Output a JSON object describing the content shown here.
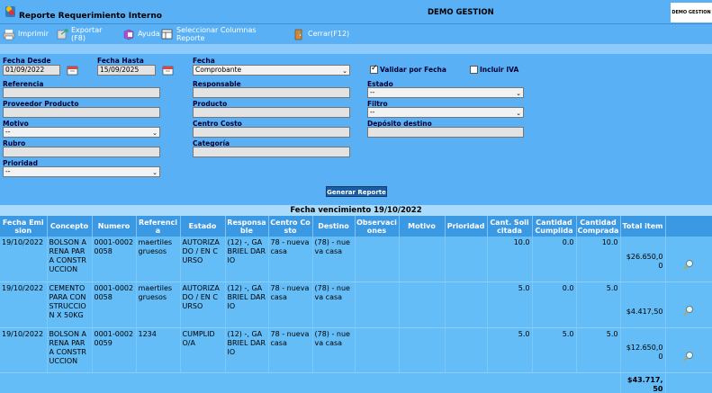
{
  "app": {
    "title": "Reporte Requerimiento Interno",
    "company": "DEMO GESTION",
    "logo_text": "DEMO GESTION"
  },
  "toolbar": {
    "print": "Imprimir",
    "export_l1": "Exportar",
    "export_l2": "(F8)",
    "help": "Ayuda",
    "columns_l1": "Seleccionar Columnas",
    "columns_l2": "Reporte",
    "close": "Cerrar(F12)"
  },
  "filters": {
    "fecha_desde_label": "Fecha Desde",
    "fecha_desde": "01/09/2022",
    "fecha_hasta_label": "Fecha Hasta",
    "fecha_hasta": "15/09/2025",
    "fecha_label": "Fecha",
    "fecha_select": "Comprobante",
    "validar_label": "Validar por Fecha",
    "validar_checked": true,
    "iva_label": "Incluir IVA",
    "iva_checked": false,
    "referencia_label": "Referencia",
    "responsable_label": "Responsable",
    "estado_label": "Estado",
    "estado_select": "--",
    "proveedor_label": "Proveedor Producto",
    "producto_label": "Producto",
    "filtro_label": "Filtro",
    "filtro_select": "--",
    "motivo_label": "Motivo",
    "motivo_select": "--",
    "centro_label": "Centro Costo",
    "deposito_label": "Depósito destino",
    "rubro_label": "Rubro",
    "categoria_label": "Categoría",
    "prioridad_label": "Prioridad",
    "prioridad_select": "--",
    "generate_button": "Generar Reporte"
  },
  "report": {
    "due_date": "Fecha vencimiento 19/10/2022",
    "columns": [
      "Fecha Emision",
      "Concepto",
      "Numero",
      "Referencia",
      "Estado",
      "Responsable",
      "Centro Costo",
      "Destino",
      "Observaciones",
      "Motivo",
      "Prioridad",
      "Cant. Solicitada",
      "Cantidad Cumplida",
      "Cantidad Comprada",
      "Total item",
      ""
    ],
    "rows": [
      {
        "fecha": "19/10/2022",
        "concepto": "BOLSON ARENA PARA CONSTRUCCION",
        "numero": "0001-00020058",
        "referencia": "maertiles gruesos",
        "estado": "AUTORIZADO / EN CURSO",
        "responsable": "(12) -, GABRIEL DARIO",
        "centro": "78 - nueva casa",
        "destino": "(78) - nueva casa",
        "observaciones": "",
        "motivo": "",
        "prioridad": "",
        "solicitada": "10.0",
        "cumplida": "0.0",
        "comprada": "10.0",
        "total": "$26.650,00"
      },
      {
        "fecha": "19/10/2022",
        "concepto": "CEMENTO PARA CONSTRUCCION X 50KG",
        "numero": "0001-00020058",
        "referencia": "maertiles gruesos",
        "estado": "AUTORIZADO / EN CURSO",
        "responsable": "(12) -, GABRIEL DARIO",
        "centro": "78 - nueva casa",
        "destino": "(78) - nueva casa",
        "observaciones": "",
        "motivo": "",
        "prioridad": "",
        "solicitada": "5.0",
        "cumplida": "0.0",
        "comprada": "5.0",
        "total": "$4.417,50"
      },
      {
        "fecha": "19/10/2022",
        "concepto": "BOLSON ARENA PARA CONSTRUCCION",
        "numero": "0001-00020059",
        "referencia": "1234",
        "estado": "CUMPLIDO/A",
        "responsable": "(12) -, GABRIEL DARIO",
        "centro": "78 - nueva casa",
        "destino": "(78) - nueva casa",
        "observaciones": "",
        "motivo": "",
        "prioridad": "",
        "solicitada": "5.0",
        "cumplida": "5.0",
        "comprada": "5.0",
        "total": "$12.650,00"
      }
    ],
    "grand_total": "$43.717,50"
  }
}
